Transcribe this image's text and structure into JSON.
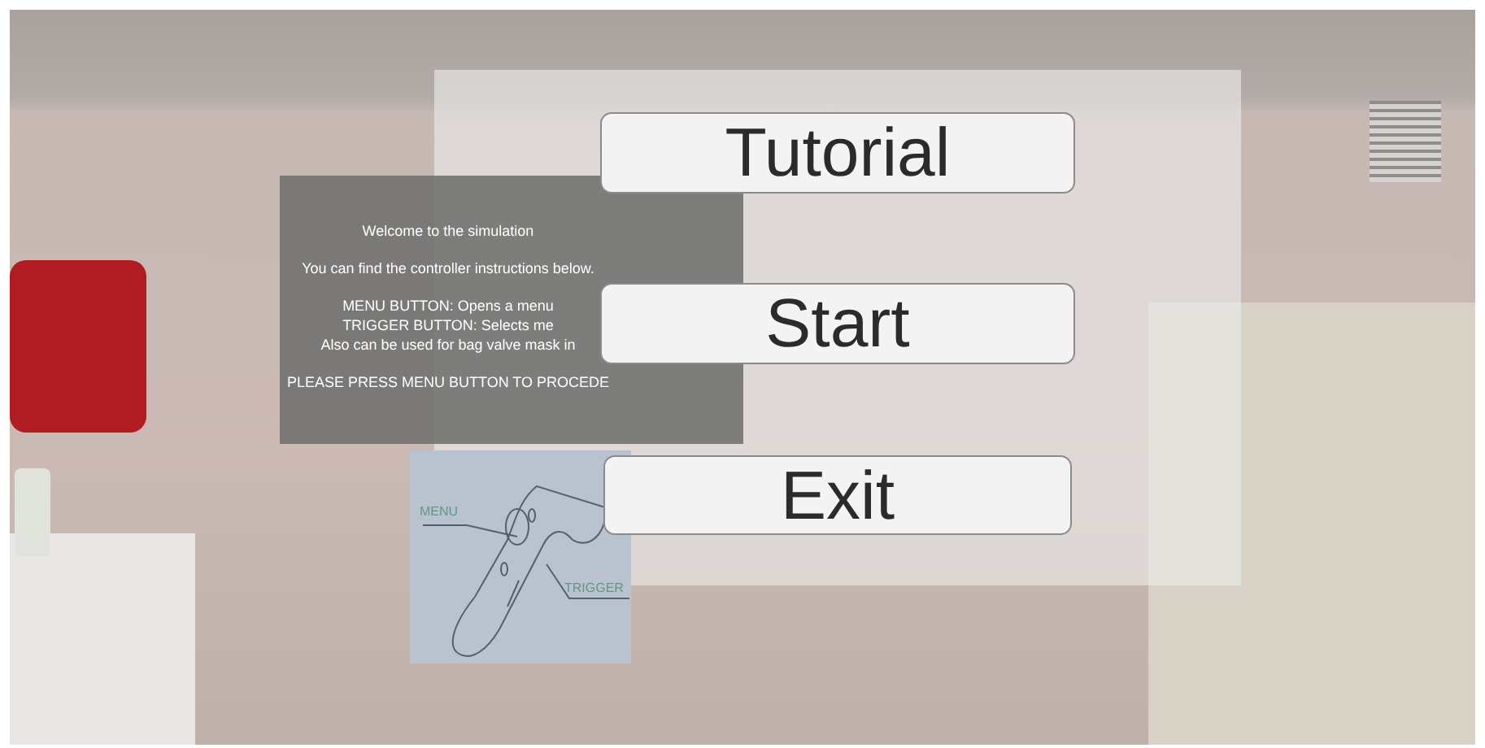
{
  "menu_buttons": [
    {
      "label": "Tutorial"
    },
    {
      "label": "Start"
    },
    {
      "label": "Exit"
    }
  ],
  "instructions": {
    "groups": [
      [
        "Welcome to the simulation"
      ],
      [
        "You can find the controller instructions below."
      ],
      [
        "MENU BUTTON: Opens a menu",
        "TRIGGER BUTTON: Selects me",
        "Also can be used for bag valve mask in"
      ],
      [
        "PLEASE PRESS MENU BUTTON TO PROCEDE"
      ]
    ]
  },
  "controller_diagram": {
    "labels": [
      "MENU",
      "TRIGGER"
    ]
  }
}
